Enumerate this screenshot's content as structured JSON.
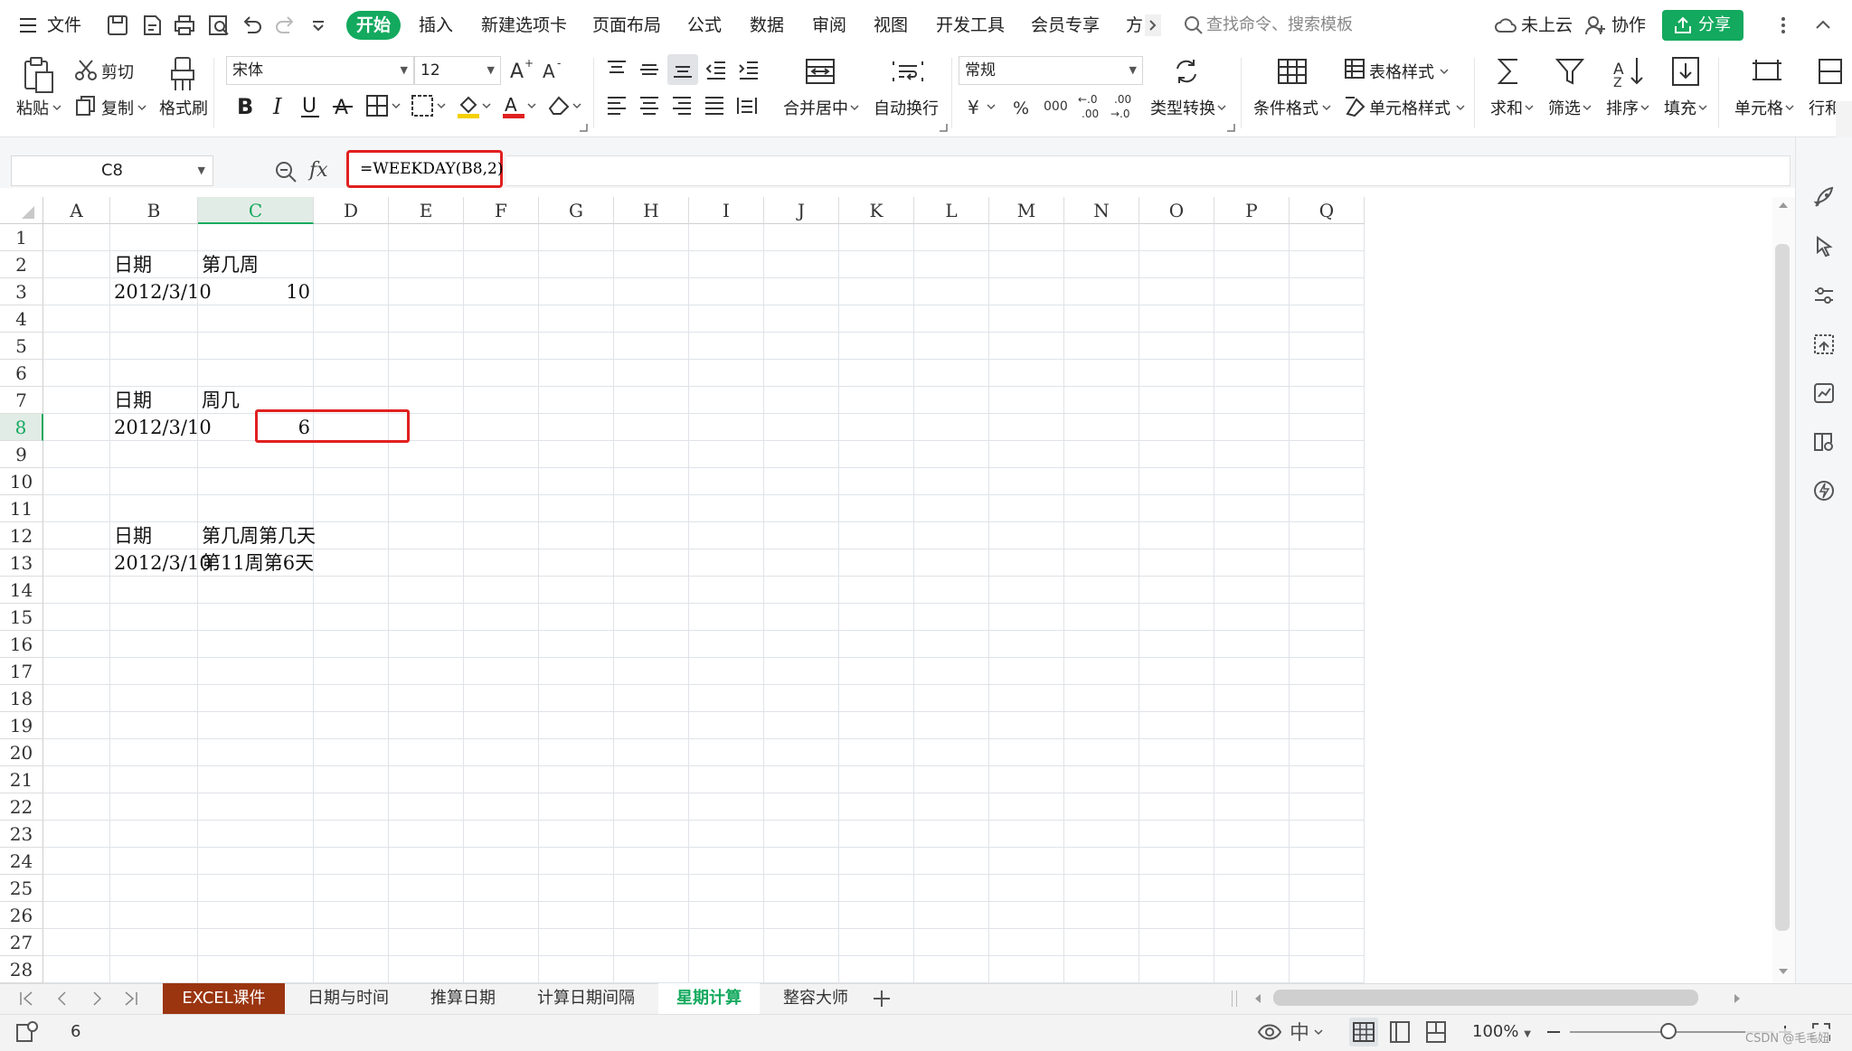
{
  "menubar": {
    "file_label": "文件",
    "tabs": [
      "开始",
      "插入",
      "新建选项卡",
      "页面布局",
      "公式",
      "数据",
      "审阅",
      "视图",
      "开发工具",
      "会员专享",
      "方"
    ],
    "search_placeholder": "查找命令、搜索模板",
    "cloud_label": "未上云",
    "collab_label": "协作",
    "share_label": "分享"
  },
  "ribbon": {
    "paste": "粘贴",
    "cut": "剪切",
    "copy": "复制",
    "format_painter": "格式刷",
    "font_name": "宋体",
    "font_size": "12",
    "number_format": "常规",
    "merge_center": "合并居中",
    "wrap_text": "自动换行",
    "type_convert": "类型转换",
    "cond_format": "条件格式",
    "table_style": "表格样式",
    "cell_style": "单元格样式",
    "sum": "求和",
    "filter": "筛选",
    "sort": "排序",
    "fill": "填充",
    "cell": "单元格",
    "row_col": "行和"
  },
  "formula_bar": {
    "name_box": "C8",
    "fx": "fx",
    "formula": "=WEEKDAY(B8,2)"
  },
  "sheet": {
    "columns": [
      "A",
      "B",
      "C",
      "D",
      "E",
      "F",
      "G",
      "H",
      "I",
      "J",
      "K",
      "L",
      "M",
      "N",
      "O",
      "P",
      "Q"
    ],
    "selected_column": "C",
    "selected_row": 8,
    "row_count": 28,
    "cells": [
      {
        "ref": "B2",
        "value": "日期",
        "align": "left"
      },
      {
        "ref": "C2",
        "value": "第几周",
        "align": "left"
      },
      {
        "ref": "B3",
        "value": "2012/3/10",
        "align": "right"
      },
      {
        "ref": "C3",
        "value": "10",
        "align": "right"
      },
      {
        "ref": "B7",
        "value": "日期",
        "align": "left"
      },
      {
        "ref": "C7",
        "value": "周几",
        "align": "left"
      },
      {
        "ref": "B8",
        "value": "2012/3/10",
        "align": "right"
      },
      {
        "ref": "C8",
        "value": "6",
        "align": "right"
      },
      {
        "ref": "B12",
        "value": "日期",
        "align": "left"
      },
      {
        "ref": "C12",
        "value": "第几周第几天",
        "align": "left"
      },
      {
        "ref": "B13",
        "value": "2012/3/10",
        "align": "right"
      },
      {
        "ref": "C13",
        "value": "第11周第6天",
        "align": "left"
      }
    ]
  },
  "sheet_tabs": [
    "EXCEL课件",
    "日期与时间",
    "推算日期",
    "计算日期间隔",
    "星期计算",
    "整容大师"
  ],
  "active_sheet": "星期计算",
  "status": {
    "cell_value": "6",
    "zoom": "100%",
    "watermark": "CSDN @毛毛妞"
  },
  "colors": {
    "accent": "#13a95e",
    "highlight": "#e02020",
    "tab_dark": "#9a3510"
  }
}
